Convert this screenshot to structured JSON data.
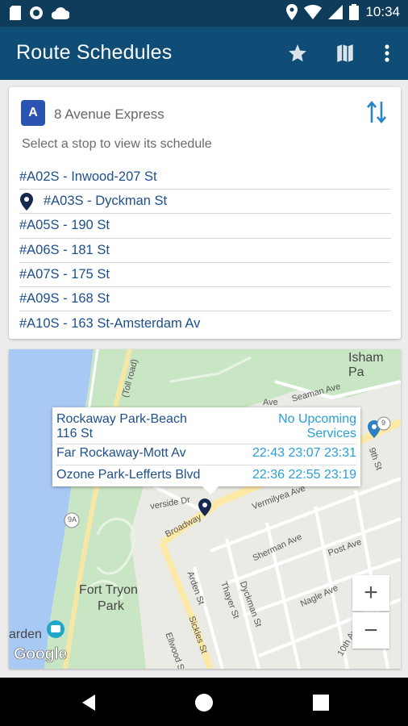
{
  "status_bar": {
    "time": "10:34"
  },
  "app_bar": {
    "title": "Route Schedules",
    "actions": [
      "star-icon",
      "map-icon",
      "overflow-menu-icon"
    ]
  },
  "route_card": {
    "badge": "A",
    "route_name": "8 Avenue Express",
    "hint": "Select a stop to view its schedule",
    "stops": [
      {
        "label": "#A02S - Inwood-207 St",
        "selected": false
      },
      {
        "label": "#A03S - Dyckman St",
        "selected": true
      },
      {
        "label": "#A05S - 190 St",
        "selected": false
      },
      {
        "label": "#A06S - 181 St",
        "selected": false
      },
      {
        "label": "#A07S - 175 St",
        "selected": false
      },
      {
        "label": "#A09S - 168 St",
        "selected": false
      },
      {
        "label": "#A10S - 163 St-Amsterdam Av",
        "selected": false
      }
    ]
  },
  "map": {
    "labels": {
      "isham": "Isham Pa",
      "fort_tryon_1": "Fort Tryon",
      "fort_tryon_2": "Park",
      "garden": "arden",
      "google": "Google"
    },
    "streets": {
      "vermilyea": "Vermilyea Ave",
      "sherman": "Sherman Ave",
      "post": "Post Ave",
      "nagle": "Nagle Ave",
      "broadway": "Broadway",
      "riverside": "verside Dr",
      "arden": "Arden St",
      "thayer": "Thayer St",
      "dyckman": "Dyckman St",
      "ellwood": "Ellwood St",
      "sickles": "Sickles St",
      "tenth": "10th Ave",
      "toll_road": "(Toll road)",
      "route_9a": "9A",
      "route_9": "9",
      "seaman": "Seaman Ave",
      "ave1": "Ave",
      "ninth": "9th St"
    },
    "info_window": {
      "rows": [
        {
          "destination_line1": "Rockaway Park-Beach",
          "destination_line2": "116 St",
          "times_line1": "No Upcoming",
          "times_line2": "Services"
        },
        {
          "destination_line1": "Far Rockaway-Mott Av",
          "times_line1": "22:43 23:07 23:31"
        },
        {
          "destination_line1": "Ozone Park-Lefferts Blvd",
          "times_line1": "22:36 22:55 23:19"
        }
      ]
    },
    "zoom_in": "+",
    "zoom_out": "−"
  },
  "colors": {
    "status_bar": "#0f3c5b",
    "app_bar": "#0f4d77",
    "route_badge": "#2b54b2",
    "stop_link": "#1d4f8d",
    "times": "#2a9fd6"
  }
}
